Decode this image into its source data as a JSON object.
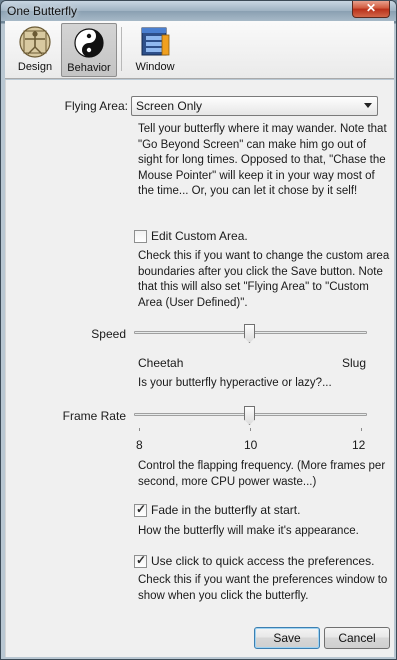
{
  "window": {
    "title": "One Butterfly",
    "close_glyph": "✕"
  },
  "toolbar": {
    "items": [
      {
        "label": "Design",
        "icon": "vitruvian-man-icon"
      },
      {
        "label": "Behavior",
        "icon": "yin-yang-icon"
      },
      {
        "label": "Window",
        "icon": "window-icon"
      }
    ],
    "active": "Behavior"
  },
  "flying_area": {
    "label": "Flying Area:",
    "value": "Screen Only",
    "description": "Tell your butterfly where it may wander. Note that \"Go Beyond Screen\" can make him go out of sight for long times. Opposed to that, \"Chase the Mouse Pointer\" will keep it in your way most of the time... Or, you can let it chose by it self!"
  },
  "custom_area": {
    "label": "Edit Custom Area.",
    "checked": false,
    "description": "Check this if you want to change the custom area boundaries after you click the Save button. Note that this will also set \"Flying Area\" to \"Custom Area (User Defined)\"."
  },
  "speed": {
    "label": "Speed",
    "min_label": "Cheetah",
    "max_label": "Slug",
    "level": 0.5,
    "description": "Is your butterfly hyperactive or lazy?..."
  },
  "frame_rate": {
    "label": "Frame Rate",
    "ticks": [
      "8",
      "10",
      "12"
    ],
    "value": 10,
    "min": 8,
    "max": 12,
    "description": "Control the flapping frequency. (More frames per second, more CPU power waste...)"
  },
  "fade_in": {
    "label": "Fade in the butterfly at start.",
    "checked": true,
    "description": "How the butterfly will make it's appearance."
  },
  "quick_access": {
    "label": "Use click to quick access the preferences.",
    "checked": true,
    "description": "Check this if you want the preferences window to show when you click the butterfly."
  },
  "buttons": {
    "save": "Save",
    "cancel": "Cancel"
  },
  "colors": {
    "titlebar": "#9fb2c2",
    "close": "#c8452b",
    "default_button_border": "#3c7fb1"
  }
}
